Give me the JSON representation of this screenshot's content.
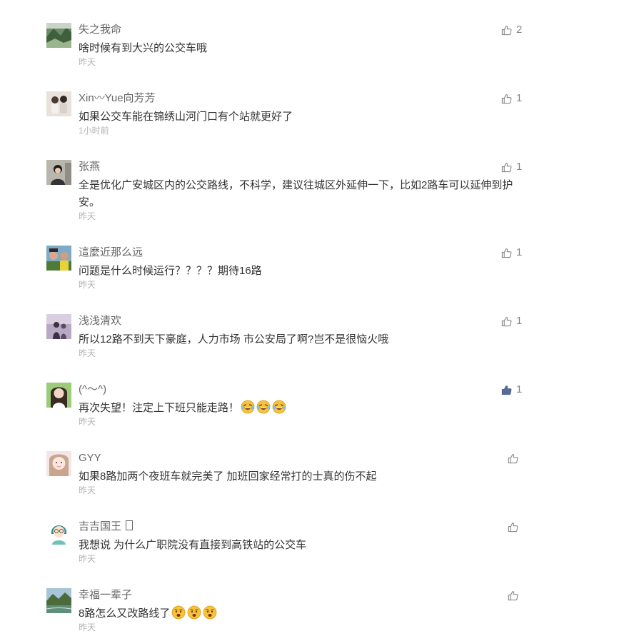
{
  "comments": [
    {
      "nickname": "失之我命",
      "content": "啥时候有到大兴的公交车哦",
      "time": "昨天",
      "likes": "2",
      "liked": false,
      "avatar_icon": "landscape-avatar-icon"
    },
    {
      "nickname": "Xin〰Yue向芳芳",
      "content": "如果公交车能在锦绣山河门口有个站就更好了",
      "time": "1小时前",
      "likes": "1",
      "liked": false,
      "avatar_icon": "couple-photo-avatar-icon"
    },
    {
      "nickname": "张燕",
      "content": "全是优化广安城区内的公交路线，不科学，建议往城区外延伸一下，比如2路车可以延伸到护安。",
      "time": "昨天",
      "likes": "1",
      "liked": false,
      "avatar_icon": "woman-portrait-avatar-icon"
    },
    {
      "nickname": "這麼近那么远",
      "content": "问题是什么时候运行？？？？期待16路",
      "time": "昨天",
      "likes": "1",
      "liked": false,
      "avatar_icon": "selfie-avatar-icon"
    },
    {
      "nickname": "浅浅清欢",
      "content": "所以12路不到天下豪庭，人力市场 市公安局了啊?岂不是很恼火哦",
      "time": "昨天",
      "likes": "1",
      "liked": false,
      "avatar_icon": "silhouette-avatar-icon"
    },
    {
      "nickname": "(^～^)",
      "content": "再次失望！注定上下班只能走路！",
      "time": "昨天",
      "likes": "1",
      "liked": true,
      "avatar_icon": "girl-portrait-avatar-icon",
      "emojis": [
        "laughing-tears-emoji",
        "laughing-tears-emoji",
        "laughing-tears-emoji"
      ]
    },
    {
      "nickname": "GYY",
      "content": "如果8路加两个夜班车就完美了 加班回家经常打的士真的伤不起",
      "time": "昨天",
      "likes": "",
      "liked": false,
      "avatar_icon": "girl-face-avatar-icon"
    },
    {
      "nickname": "吉吉国王 ",
      "content": "我想说 为什么广职院没有直接到高铁站的公交车",
      "time": "昨天",
      "likes": "",
      "liked": false,
      "avatar_icon": "cartoon-girl-avatar-icon",
      "badge_icon": "unknown-glyph-icon"
    },
    {
      "nickname": "幸福一辈子",
      "content": "8路怎么又改路线了",
      "time": "昨天",
      "likes": "",
      "liked": false,
      "avatar_icon": "river-landscape-avatar-icon",
      "emojis": [
        "surprised-emoji",
        "surprised-emoji",
        "surprised-emoji"
      ]
    }
  ],
  "colors": {
    "nickname": "#666666",
    "content": "#333333",
    "time": "#b2b2b2",
    "like_icon": "#888888",
    "like_icon_active": "#576b95"
  }
}
